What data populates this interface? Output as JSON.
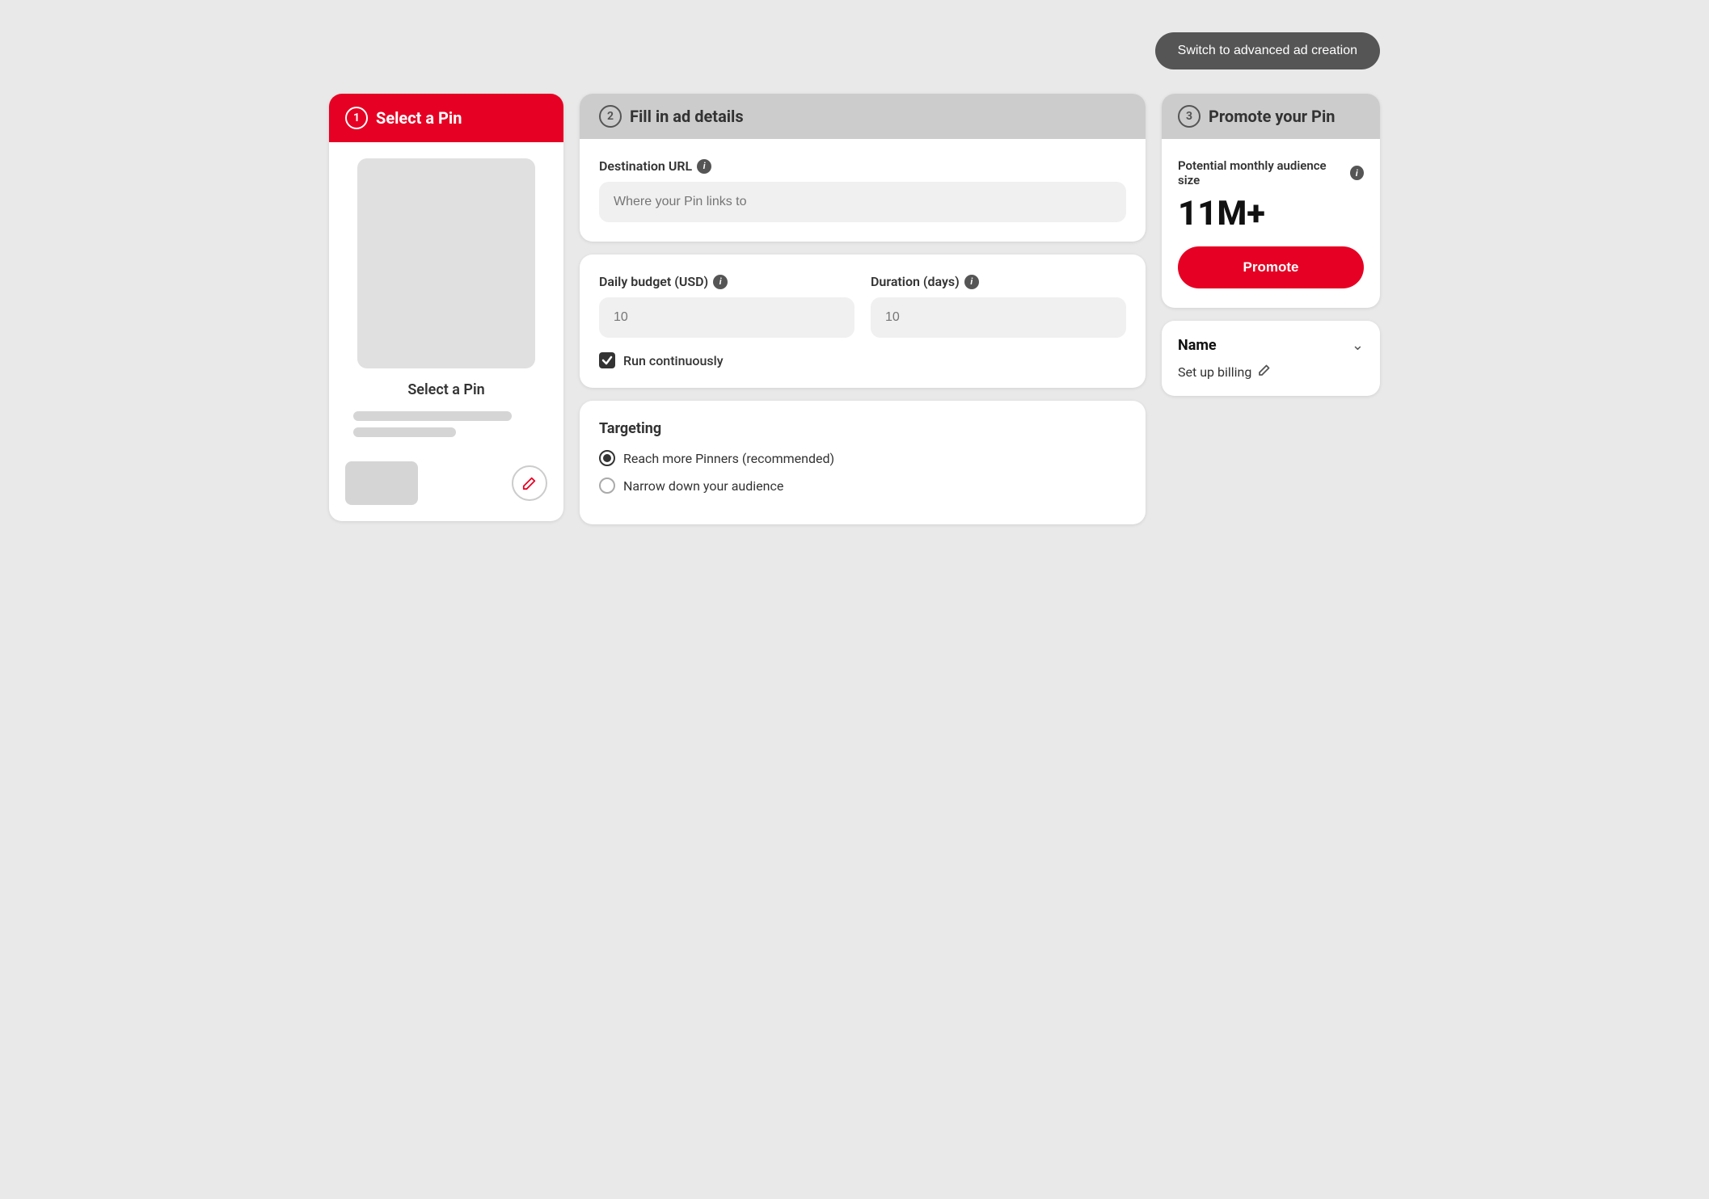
{
  "topBar": {
    "switchBtn": "Switch to advanced ad creation"
  },
  "panel1": {
    "stepNumber": "1",
    "headerTitle": "Select a Pin",
    "centerLabel": "Select a Pin"
  },
  "panel2": {
    "stepNumber": "2",
    "headerTitle": "Fill in ad details",
    "destinationURL": {
      "label": "Destination URL",
      "placeholder": "Where your Pin links to"
    },
    "dailyBudget": {
      "label": "Daily budget (USD)",
      "placeholder": "10"
    },
    "duration": {
      "label": "Duration (days)",
      "placeholder": "10"
    },
    "runContinuously": "Run continuously",
    "targeting": {
      "title": "Targeting",
      "option1": "Reach more Pinners (recommended)",
      "option2": "Narrow down your audience"
    }
  },
  "panel3": {
    "stepNumber": "3",
    "headerTitle": "Promote your Pin",
    "audienceLabel": "Potential monthly audience size",
    "audienceSize": "11M+",
    "promoteBtn": "Promote",
    "billingName": "Name",
    "setupBilling": "Set up billing"
  }
}
